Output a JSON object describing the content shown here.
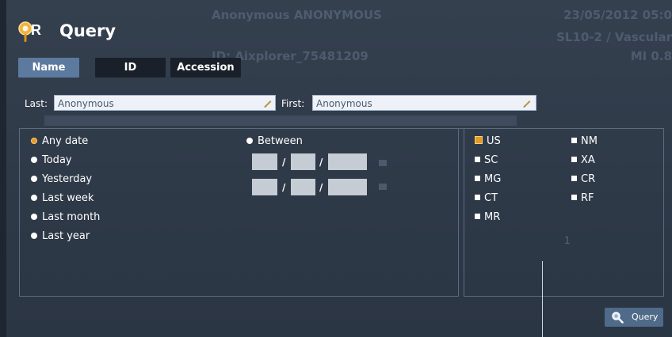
{
  "background": {
    "patient_name": "Anonymous ANONYMOUS",
    "date": "23/05/2012 05:0",
    "probe": "SL10-2 / Vascular",
    "patient_id": "ID: Aixplorer_75481209",
    "mi": "MI 0.8"
  },
  "title": "Query",
  "tabs": [
    {
      "label": "Name",
      "active": true
    },
    {
      "label": "ID",
      "active": false
    },
    {
      "label": "Accession",
      "active": false
    }
  ],
  "name_fields": {
    "last_label": "Last:",
    "last_value": "Anonymous",
    "first_label": "First:",
    "first_value": "Anonymous"
  },
  "date_options": [
    {
      "label": "Any date",
      "selected": true
    },
    {
      "label": "Today",
      "selected": false
    },
    {
      "label": "Yesterday",
      "selected": false
    },
    {
      "label": "Last week",
      "selected": false
    },
    {
      "label": "Last month",
      "selected": false
    },
    {
      "label": "Last year",
      "selected": false
    }
  ],
  "between_label": "Between",
  "date_separator": "/",
  "modalities": [
    {
      "label": "US",
      "checked": true
    },
    {
      "label": "NM",
      "checked": false
    },
    {
      "label": "SC",
      "checked": false
    },
    {
      "label": "XA",
      "checked": false
    },
    {
      "label": "MG",
      "checked": false
    },
    {
      "label": "CR",
      "checked": false
    },
    {
      "label": "CT",
      "checked": false
    },
    {
      "label": "RF",
      "checked": false
    },
    {
      "label": "MR",
      "checked": false
    }
  ],
  "ghost_number": "1",
  "query_button": "Query",
  "colors": {
    "accent_orange": "#e49a24",
    "active_tab": "#5c7a9e",
    "background": "#2f3b4a",
    "field_bg": "#eef2f8"
  },
  "icons": [
    "qr-logo-icon",
    "pencil-icon",
    "calendar-icon",
    "magnifier-icon"
  ]
}
